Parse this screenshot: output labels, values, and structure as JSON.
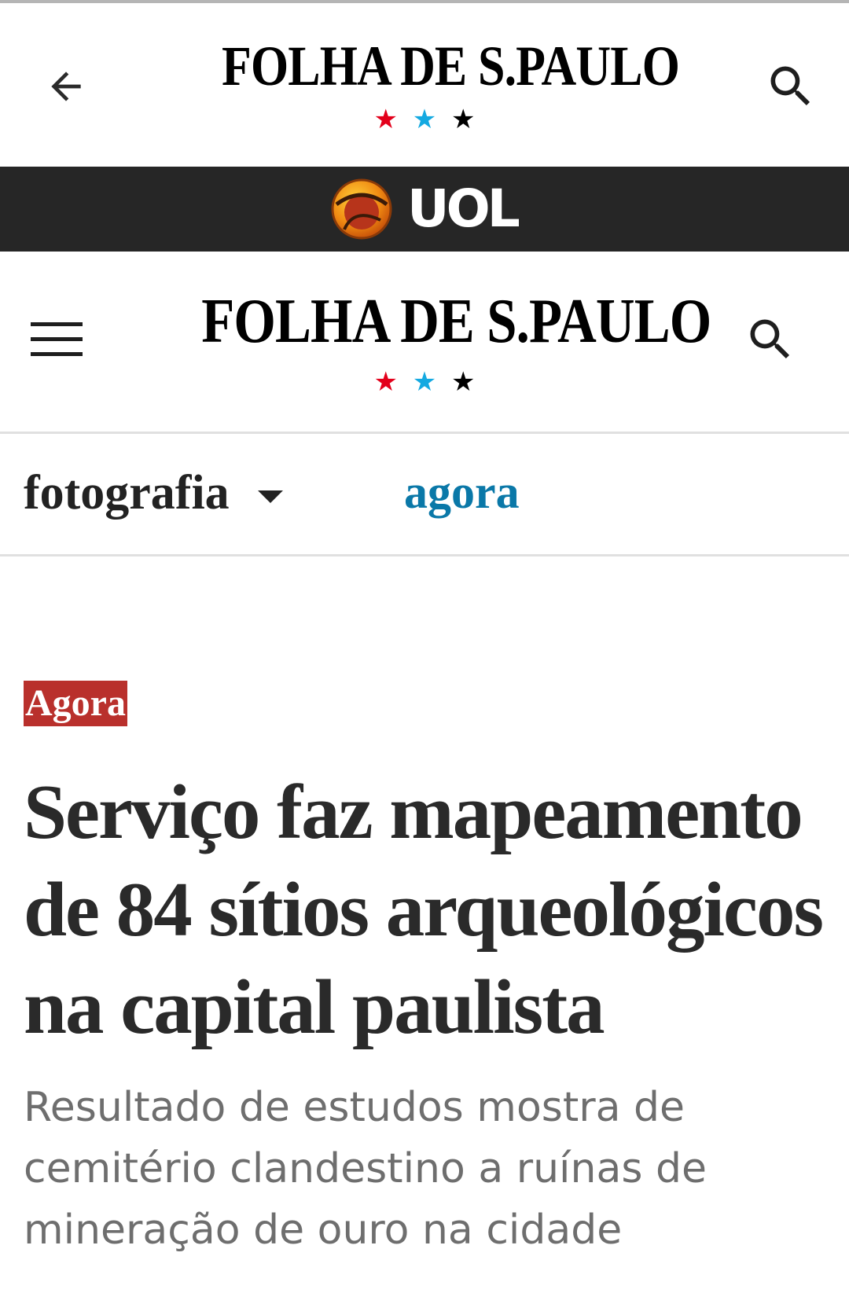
{
  "app_bar": {
    "back_icon": "arrow-left-icon",
    "logo_text": "FOLHA DE S.PAULO",
    "search_icon": "search-icon",
    "stars": [
      "★",
      "★",
      "★"
    ],
    "star_colors": [
      "#e3001b",
      "#14a9e1",
      "#000000"
    ]
  },
  "uol_bar": {
    "logo_text": "UOL",
    "logo_icon": "uol-globe-icon",
    "background": "#262626"
  },
  "site_header": {
    "menu_icon": "hamburger-menu-icon",
    "logo_text": "FOLHA DE S.PAULO",
    "search_icon": "search-icon"
  },
  "section_nav": {
    "current_section": "fotografia",
    "dropdown_icon": "caret-down-icon",
    "subsection_link": "agora",
    "link_color": "#0a78a8"
  },
  "article": {
    "kicker": "Agora",
    "kicker_color": "#b9302c",
    "headline": "Serviço faz mapeamento de 84 sítios arqueológicos na capital paulista",
    "subtitle": "Resultado de estudos mostra de cemitério clandestino a ruínas de mineração de ouro na cidade"
  }
}
